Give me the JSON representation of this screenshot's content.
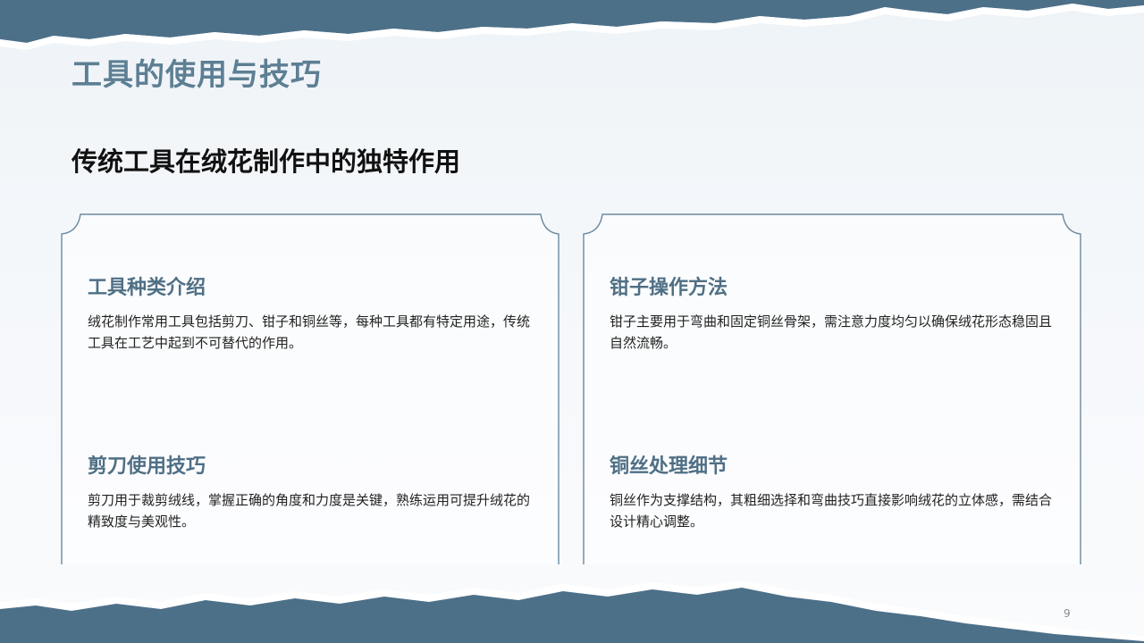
{
  "title": "工具的使用与技巧",
  "subtitle": "传统工具在绒花制作中的独特作用",
  "cards": [
    {
      "heading": "工具种类介绍",
      "text": "绒花制作常用工具包括剪刀、钳子和铜丝等，每种工具都有特定用途，传统工具在工艺中起到不可替代的作用。"
    },
    {
      "heading": "钳子操作方法",
      "text": "钳子主要用于弯曲和固定铜丝骨架，需注意力度均匀以确保绒花形态稳固且自然流畅。"
    },
    {
      "heading": "剪刀使用技巧",
      "text": "剪刀用于裁剪绒线，掌握正确的角度和力度是关键，熟练运用可提升绒花的精致度与美观性。"
    },
    {
      "heading": "铜丝处理细节",
      "text": "铜丝作为支撑结构，其粗细选择和弯曲技巧直接影响绒花的立体感，需结合设计精心调整。"
    }
  ],
  "page_number": "9",
  "colors": {
    "accent": "#5d7f93",
    "heading": "#4f6f85",
    "decoration": "#50758d",
    "frame": "#6a8aa0"
  }
}
